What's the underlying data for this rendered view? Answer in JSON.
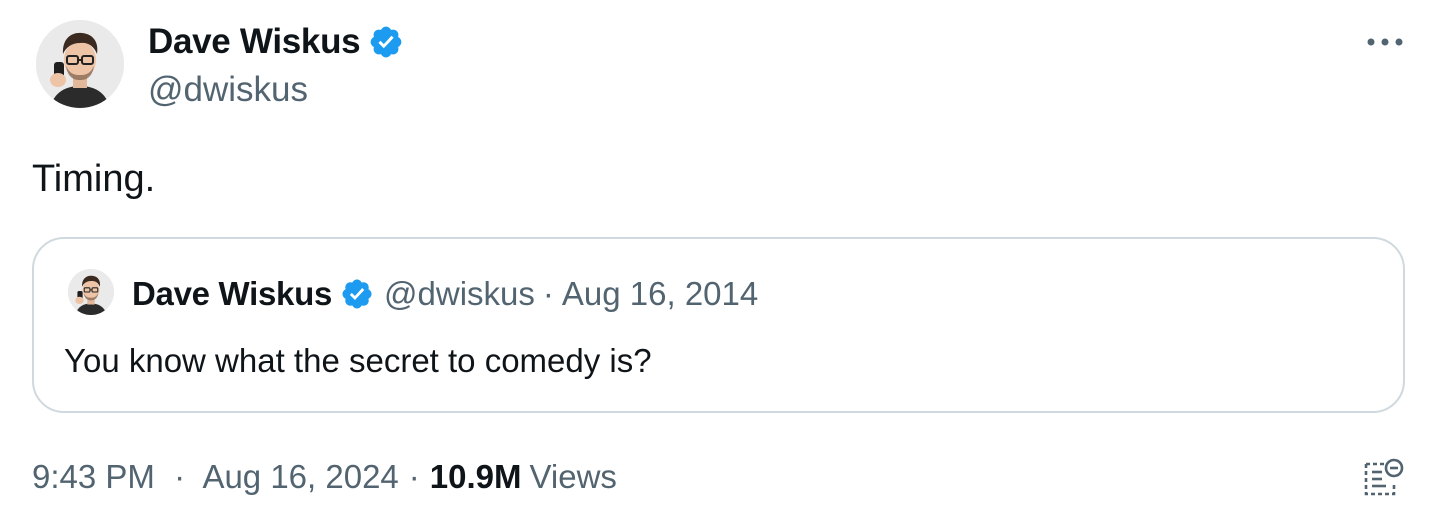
{
  "author": {
    "display_name": "Dave Wiskus",
    "handle": "@dwiskus"
  },
  "colors": {
    "verified": "#1d9bf0",
    "secondary_text": "#536471",
    "border": "#cfd9de"
  },
  "icons": {
    "verified": "verified-badge-icon",
    "more": "more-dots-icon",
    "analytics": "analytics-icon"
  },
  "tweet": {
    "text": "Timing."
  },
  "quoted_tweet": {
    "display_name": "Dave Wiskus",
    "handle": "@dwiskus",
    "separator": "·",
    "date": "Aug 16, 2014",
    "text": "You know what the secret to comedy is?"
  },
  "meta": {
    "time": "9:43 PM",
    "separator": "·",
    "date": "Aug 16, 2024",
    "views_count": "10.9M",
    "views_label": "Views"
  }
}
